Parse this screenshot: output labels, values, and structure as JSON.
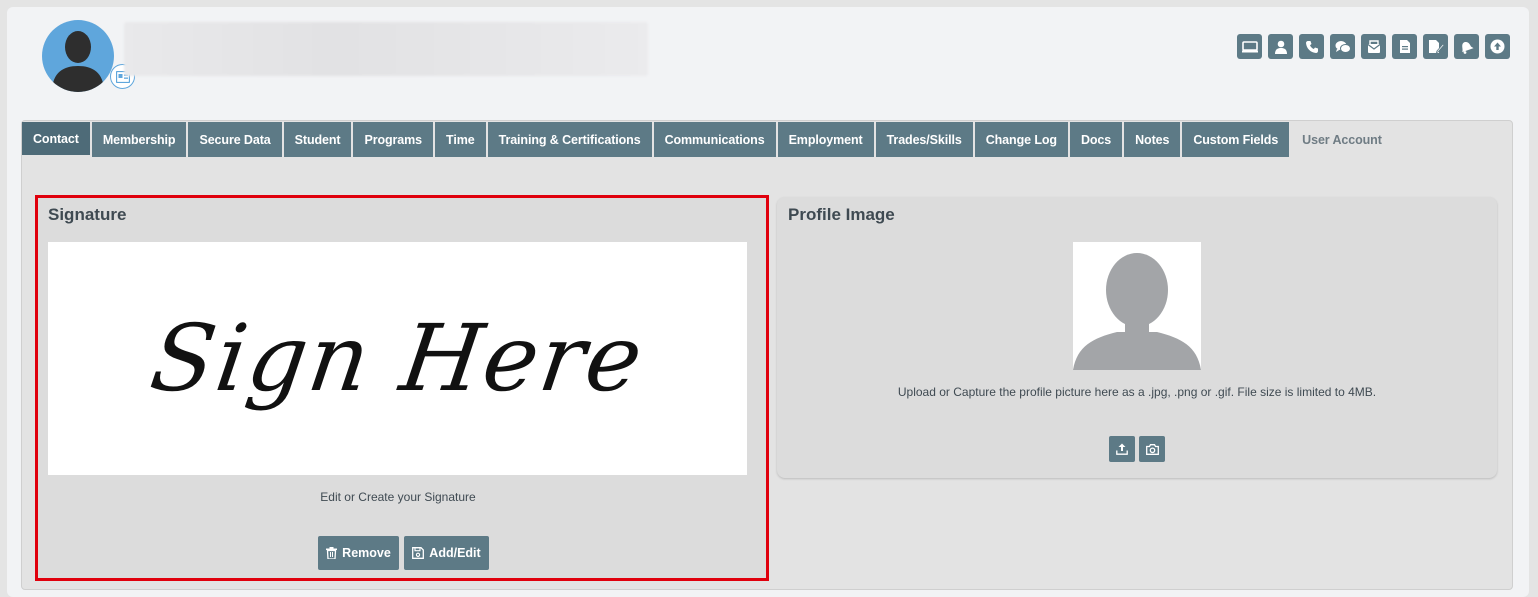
{
  "header": {
    "action_icons": [
      "id-card-icon",
      "user-icon",
      "phone-icon",
      "chat-icon",
      "mail-icon",
      "document-icon",
      "edit-document-icon",
      "bell-icon",
      "upload-circle-icon"
    ]
  },
  "tabs": [
    {
      "label": "Contact",
      "active": true
    },
    {
      "label": "Membership"
    },
    {
      "label": "Secure Data"
    },
    {
      "label": "Student"
    },
    {
      "label": "Programs"
    },
    {
      "label": "Time"
    },
    {
      "label": "Training & Certifications"
    },
    {
      "label": "Communications"
    },
    {
      "label": "Employment"
    },
    {
      "label": "Trades/Skills"
    },
    {
      "label": "Change Log"
    },
    {
      "label": "Docs"
    },
    {
      "label": "Notes"
    },
    {
      "label": "Custom Fields"
    },
    {
      "label": "User Account",
      "plain": true
    }
  ],
  "signature": {
    "title": "Signature",
    "image_text": "Sign Here",
    "helper": "Edit or Create your Signature",
    "remove_label": "Remove",
    "add_edit_label": "Add/Edit"
  },
  "profile": {
    "title": "Profile Image",
    "helper": "Upload or Capture the profile picture here as a .jpg, .png or .gif. File size is limited to 4MB."
  },
  "colors": {
    "accent": "#5d7a86",
    "highlight": "#e0000d",
    "avatar_bg": "#5fa6dc"
  }
}
